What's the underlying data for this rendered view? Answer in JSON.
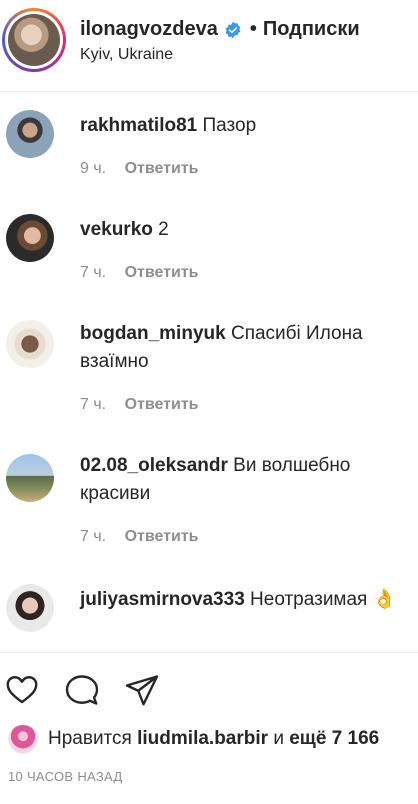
{
  "header": {
    "username": "ilonagvozdeva",
    "separator": "•",
    "follow_status": "Подписки",
    "location": "Kyiv, Ukraine"
  },
  "comments": [
    {
      "user": "rakhmatilo81",
      "text": "Пазор",
      "time": "9 ч.",
      "reply": "Ответить"
    },
    {
      "user": "vekurko",
      "text": "2",
      "time": "7 ч.",
      "reply": "Ответить"
    },
    {
      "user": "bogdan_minyuk",
      "text": "Спасибі Илона взаїмно",
      "time": "7 ч.",
      "reply": "Ответить"
    },
    {
      "user": "02.08_oleksandr",
      "text": "Ви волшебно красиви",
      "time": "7 ч.",
      "reply": "Ответить"
    },
    {
      "user": "juliyasmirnova333",
      "text": "Неотразимая 👌",
      "time": "",
      "reply": ""
    }
  ],
  "actions": {
    "like_icon": "heart-icon",
    "comment_icon": "comment-icon",
    "share_icon": "share-icon"
  },
  "likes": {
    "prefix": "Нравится",
    "user": "liudmila.barbir",
    "middle": "и",
    "others": "ещё 7 166"
  },
  "post_time": "10 ЧАСОВ НАЗАД",
  "colors": {
    "text": "#262626",
    "secondary": "#8e8e8e",
    "verified": "#3897f0",
    "divider": "#efefef"
  }
}
